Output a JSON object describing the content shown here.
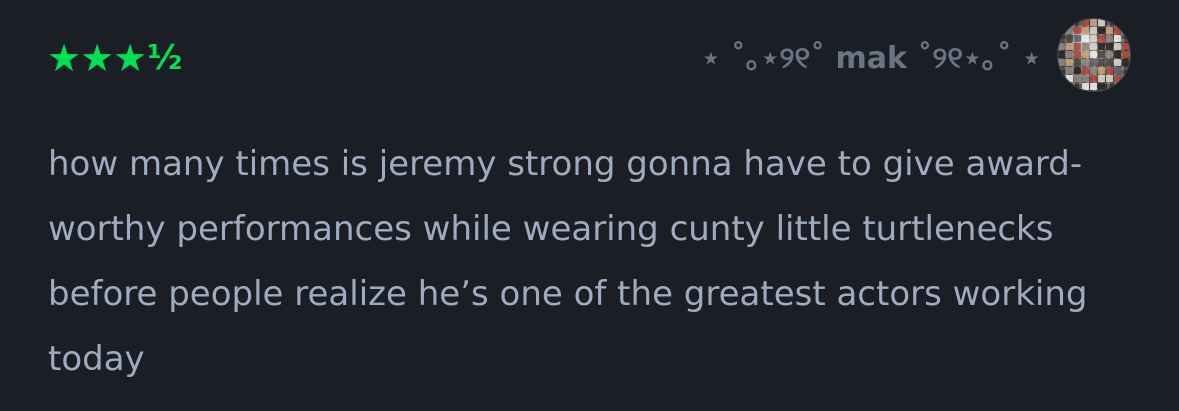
{
  "review": {
    "rating": {
      "value": 3.5,
      "max": 5,
      "stars": [
        "★",
        "★",
        "★"
      ],
      "half": "½",
      "accent_color": "#00e054"
    },
    "author": {
      "display_name": "⋆ ˚｡⋆୨୧˚ mak ˚୨୧⋆｡˚ ⋆",
      "avatar_icon": "disco-ball-avatar"
    },
    "body": "how many times is jeremy strong gonna have to give award-worthy performances while wearing cunty little turtlenecks before people realize he’s one of the greatest actors working today"
  },
  "colors": {
    "background": "#1b1e24",
    "text": "#9eabc0",
    "author": "#687585",
    "rating": "#00e054"
  }
}
